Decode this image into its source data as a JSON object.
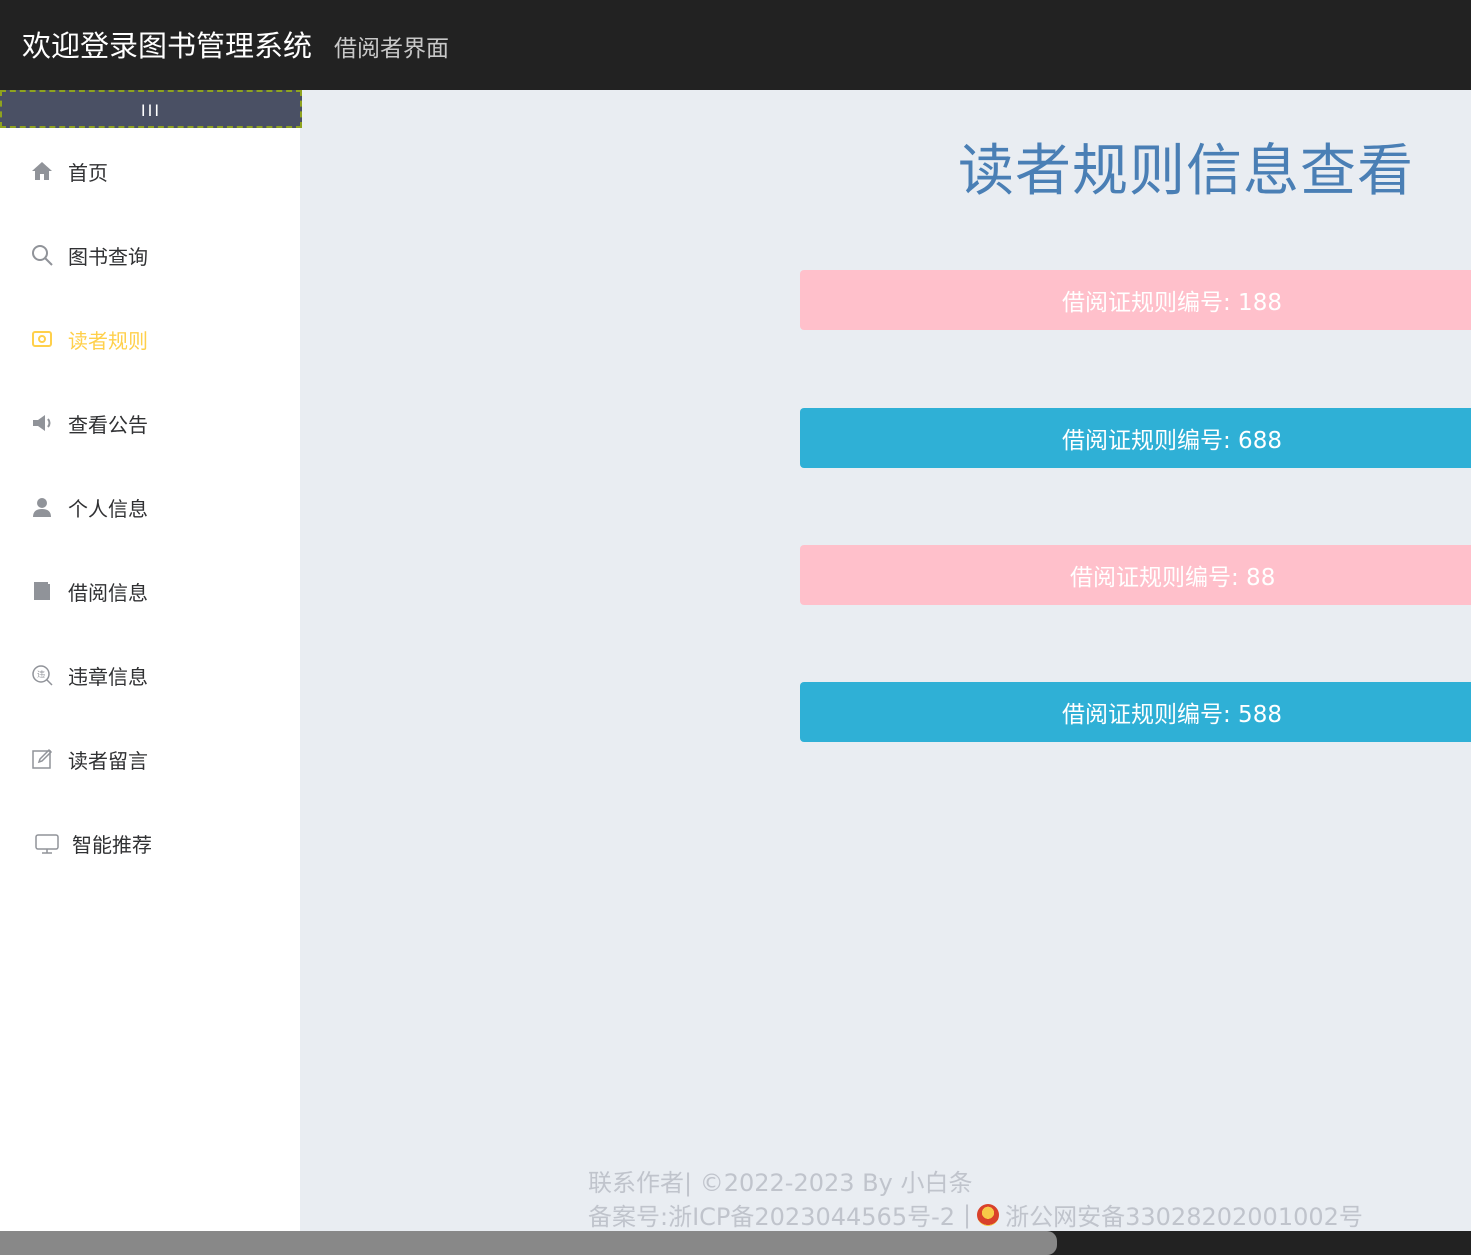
{
  "header": {
    "title": "欢迎登录图书管理系统",
    "subtitle": "借阅者界面"
  },
  "sidebar": {
    "collapse_label": "III",
    "items": [
      {
        "label": "首页",
        "icon": "home-icon"
      },
      {
        "label": "图书查询",
        "icon": "search-icon"
      },
      {
        "label": "读者规则",
        "icon": "rules-icon",
        "active": true
      },
      {
        "label": "查看公告",
        "icon": "megaphone-icon"
      },
      {
        "label": "个人信息",
        "icon": "user-icon"
      },
      {
        "label": "借阅信息",
        "icon": "book-icon"
      },
      {
        "label": "违章信息",
        "icon": "violation-icon"
      },
      {
        "label": "读者留言",
        "icon": "edit-icon"
      },
      {
        "label": "智能推荐",
        "icon": "monitor-icon"
      }
    ]
  },
  "main": {
    "page_title": "读者规则信息查看",
    "rules": [
      {
        "text": "借阅证规则编号: 188",
        "color": "#ffc0cb"
      },
      {
        "text": "借阅证规则编号: 688",
        "color": "#2fb0d6"
      },
      {
        "text": "借阅证规则编号: 88",
        "color": "#ffc0cb"
      },
      {
        "text": "借阅证规则编号: 588",
        "color": "#2fb0d6"
      }
    ]
  },
  "footer": {
    "contact": "联系作者| ©2022-2023 By 小白条",
    "icp": "备案号:浙ICP备2023044565号-2",
    "separator": "|",
    "police": "浙公网安备33028202001002号"
  },
  "colors": {
    "header_bg": "#222222",
    "active_menu": "#ffd04b",
    "title": "#4a7fb5"
  }
}
